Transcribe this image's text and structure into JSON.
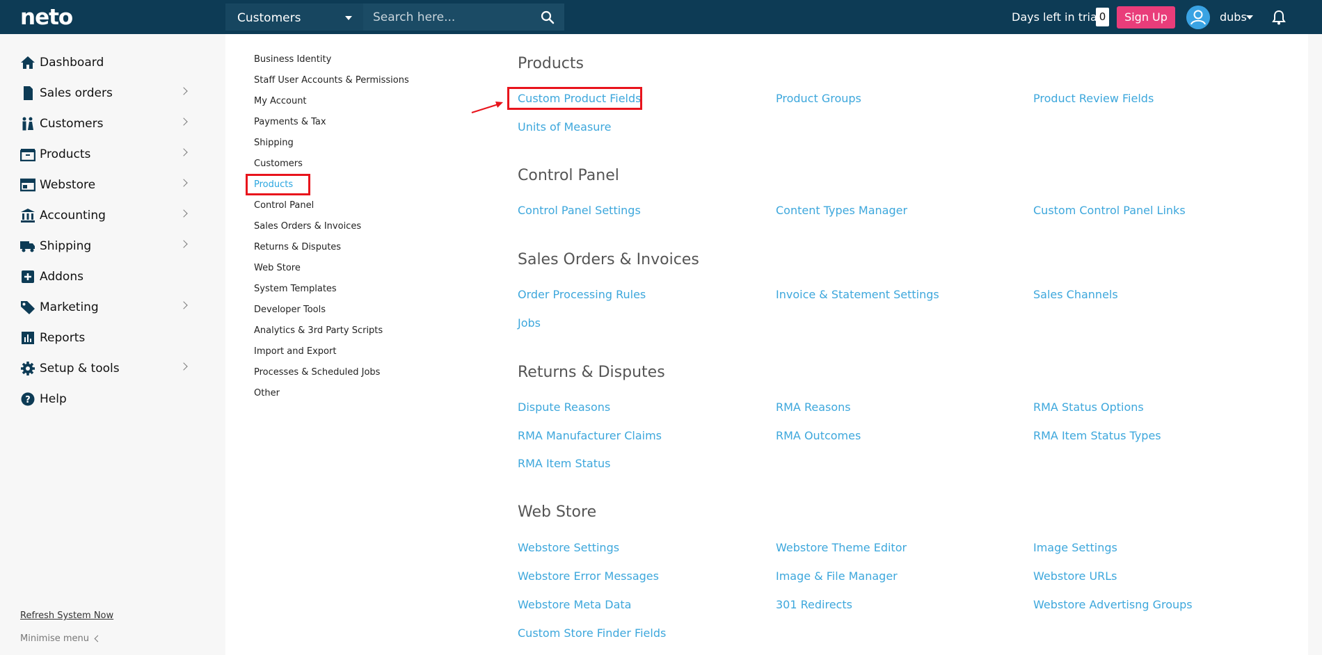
{
  "topbar": {
    "logo": "neto",
    "search_scope": "Customers",
    "search_placeholder": "Search here...",
    "trial_label": "Days left in trial",
    "trial_days": "0",
    "signup_label": "Sign Up",
    "user_name": "dubs"
  },
  "sidebar": {
    "items": [
      {
        "label": "Dashboard",
        "icon": "home-icon",
        "chevron": false
      },
      {
        "label": "Sales orders",
        "icon": "document-icon",
        "chevron": true
      },
      {
        "label": "Customers",
        "icon": "people-icon",
        "chevron": true
      },
      {
        "label": "Products",
        "icon": "box-icon",
        "chevron": true
      },
      {
        "label": "Webstore",
        "icon": "browser-icon",
        "chevron": true
      },
      {
        "label": "Accounting",
        "icon": "bank-icon",
        "chevron": true
      },
      {
        "label": "Shipping",
        "icon": "truck-icon",
        "chevron": true
      },
      {
        "label": "Addons",
        "icon": "plus-square-icon",
        "chevron": false
      },
      {
        "label": "Marketing",
        "icon": "tag-icon",
        "chevron": true
      },
      {
        "label": "Reports",
        "icon": "bar-chart-icon",
        "chevron": false
      },
      {
        "label": "Setup & tools",
        "icon": "gear-icon",
        "chevron": true
      },
      {
        "label": "Help",
        "icon": "help-icon",
        "chevron": false
      }
    ],
    "refresh_label": "Refresh System Now",
    "minimise_label": "Minimise menu"
  },
  "settings_menu": {
    "items": [
      "Business Identity",
      "Staff User Accounts & Permissions",
      "My Account",
      "Payments & Tax",
      "Shipping",
      "Customers",
      "Products",
      "Control Panel",
      "Sales Orders & Invoices",
      "Returns & Disputes",
      "Web Store",
      "System Templates",
      "Developer Tools",
      "Analytics & 3rd Party Scripts",
      "Import and Export",
      "Processes & Scheduled Jobs",
      "Other"
    ],
    "active": "Products"
  },
  "content": {
    "sections": [
      {
        "title": "Products",
        "links": [
          "Custom Product Fields",
          "Product Groups",
          "Product Review Fields",
          "Units of Measure"
        ]
      },
      {
        "title": "Control Panel",
        "links": [
          "Control Panel Settings",
          "Content Types Manager",
          "Custom Control Panel Links"
        ]
      },
      {
        "title": "Sales Orders & Invoices",
        "links": [
          "Order Processing Rules",
          "Invoice & Statement Settings",
          "Sales Channels",
          "Jobs"
        ]
      },
      {
        "title": "Returns & Disputes",
        "links": [
          "Dispute Reasons",
          "RMA Reasons",
          "RMA Status Options",
          "RMA Manufacturer Claims",
          "RMA Outcomes",
          "RMA Item Status Types",
          "RMA Item Status"
        ]
      },
      {
        "title": "Web Store",
        "links": [
          "Webstore Settings",
          "Webstore Theme Editor",
          "Image Settings",
          "Webstore Error Messages",
          "Image & File Manager",
          "Webstore URLs",
          "Webstore Meta Data",
          "301 Redirects",
          "Webstore Advertisng Groups",
          "Custom Store Finder Fields"
        ]
      }
    ]
  },
  "colors": {
    "topbar": "#0d3b55",
    "link": "#3da7dc",
    "signup": "#e93d7a",
    "highlight": "#e8141c"
  }
}
